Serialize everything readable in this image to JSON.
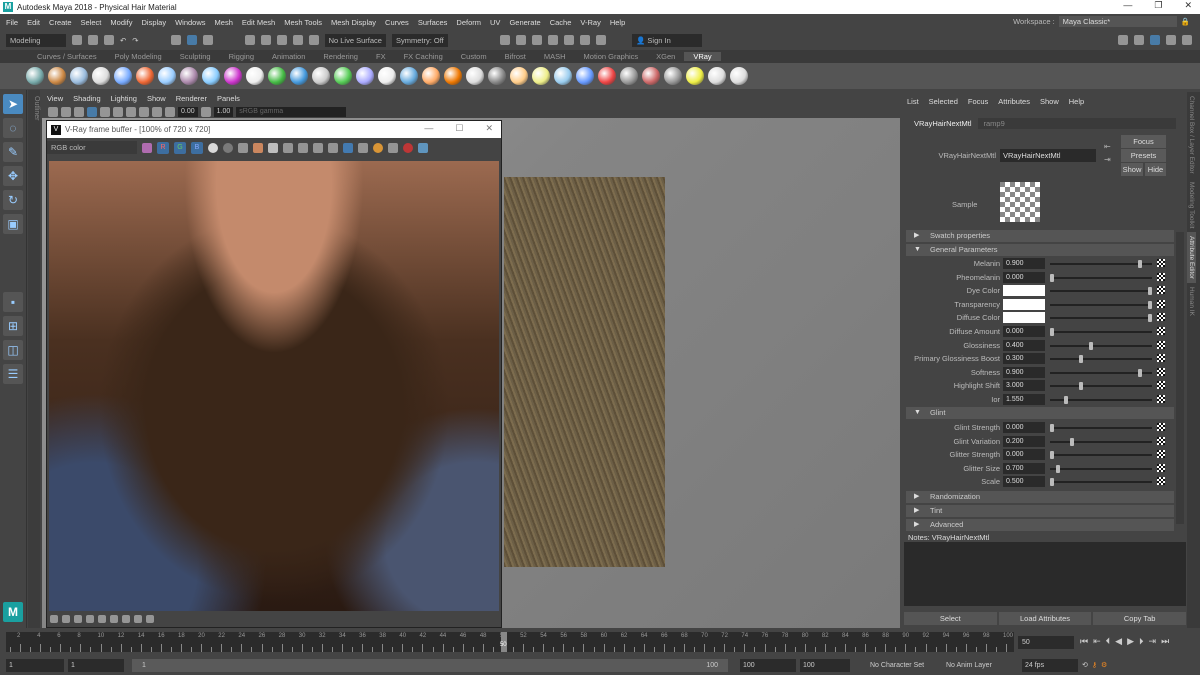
{
  "window": {
    "title": "Autodesk Maya 2018 - Physical Hair Material",
    "minimize": "—",
    "restore": "❐",
    "close": "✕",
    "logo": "M"
  },
  "menubar": {
    "items": [
      "File",
      "Edit",
      "Create",
      "Select",
      "Modify",
      "Display",
      "Windows",
      "Mesh",
      "Edit Mesh",
      "Mesh Tools",
      "Mesh Display",
      "Curves",
      "Surfaces",
      "Deform",
      "UV",
      "Generate",
      "Cache",
      "V-Ray",
      "Help"
    ],
    "workspace_label": "Workspace :",
    "workspace_value": "Maya Classic*"
  },
  "statusline": {
    "mode": "Modeling",
    "live_surface": "No Live Surface",
    "symmetry": "Symmetry: Off",
    "sign_in": "Sign In"
  },
  "shelf": {
    "tabs": [
      "Curves / Surfaces",
      "Poly Modeling",
      "Sculpting",
      "Rigging",
      "Animation",
      "Rendering",
      "FX",
      "FX Caching",
      "Custom",
      "Bifrost",
      "MASH",
      "Motion Graphics",
      "XGen",
      "VRay"
    ],
    "active": "VRay",
    "icon_colors": [
      "#7aa",
      "#c84",
      "#9bd",
      "#ddd",
      "#7af",
      "#e63",
      "#9cf",
      "#a8a",
      "#8cf",
      "#c3c",
      "#eee",
      "#4b4",
      "#49d",
      "#ccc",
      "#5c5",
      "#aaf",
      "#eee",
      "#6ad",
      "#fa6",
      "#e70",
      "#ddd",
      "#888",
      "#fc8",
      "#ee8",
      "#9ce",
      "#69f",
      "#e44",
      "#999",
      "#c66",
      "#999",
      "#ee4",
      "#ddd",
      "#ddd"
    ]
  },
  "toolbox": {
    "outliner_tab": "Outliner"
  },
  "viewport": {
    "menu": [
      "View",
      "Shading",
      "Lighting",
      "Show",
      "Renderer",
      "Panels"
    ],
    "field1": "0.00",
    "field2": "1.00",
    "colorspace": "sRGB gamma"
  },
  "vfb": {
    "title": "V-Ray frame buffer - [100% of 720 x 720]",
    "channel": "RGB color",
    "logo": "V",
    "r": "R",
    "g": "G",
    "b": "B"
  },
  "attribute_editor": {
    "menu": [
      "List",
      "Selected",
      "Focus",
      "Attributes",
      "Show",
      "Help"
    ],
    "tabs": [
      "VRayHairNextMtl",
      "ramp9"
    ],
    "node_label": "VRayHairNextMtl",
    "node_value": "VRayHairNextMtl",
    "focus": "Focus",
    "presets": "Presets",
    "show": "Show",
    "hide": "Hide",
    "sample_label": "Sample",
    "sections": {
      "swatch": "Swatch properties",
      "general": "General Parameters",
      "glint": "Glint",
      "randomization": "Randomization",
      "tint": "Tint",
      "advanced": "Advanced"
    },
    "general": [
      {
        "label": "Melanin",
        "value": "0.900",
        "slider_pos": 0.9
      },
      {
        "label": "Pheomelanin",
        "value": "0.000",
        "slider_pos": 0.0
      },
      {
        "label": "Dye Color",
        "value": "",
        "color": "#ffffff",
        "slider_pos": 1.0
      },
      {
        "label": "Transparency",
        "value": "",
        "color": "#ffffff",
        "slider_pos": 1.0
      },
      {
        "label": "Diffuse Color",
        "value": "",
        "color": "#ffffff",
        "slider_pos": 1.0
      },
      {
        "label": "Diffuse Amount",
        "value": "0.000",
        "slider_pos": 0.0
      },
      {
        "label": "Glossiness",
        "value": "0.400",
        "slider_pos": 0.4
      },
      {
        "label": "Primary Glossiness Boost",
        "value": "0.300",
        "slider_pos": 0.3
      },
      {
        "label": "Softness",
        "value": "0.900",
        "slider_pos": 0.9
      },
      {
        "label": "Highlight Shift",
        "value": "3.000",
        "slider_pos": 0.3
      },
      {
        "label": "Ior",
        "value": "1.550",
        "slider_pos": 0.14
      }
    ],
    "glint": [
      {
        "label": "Glint Strength",
        "value": "0.000",
        "slider_pos": 0.0
      },
      {
        "label": "Glint Variation",
        "value": "0.200",
        "slider_pos": 0.2
      },
      {
        "label": "Glitter Strength",
        "value": "0.000",
        "slider_pos": 0.0
      },
      {
        "label": "Glitter Size",
        "value": "0.700",
        "slider_pos": 0.06
      },
      {
        "label": "Scale",
        "value": "0.500",
        "slider_pos": 0.0
      }
    ],
    "notes_label": "Notes:  VRayHairNextMtl",
    "buttons": [
      "Select",
      "Load Attributes",
      "Copy Tab"
    ]
  },
  "right_tabs": [
    "Channel Box / Layer Editor",
    "Modeling Toolkit",
    "Attribute Editor",
    "Human IK"
  ],
  "timeline": {
    "start": 1,
    "end": 100,
    "current": "50",
    "tick_labels": [
      2,
      4,
      6,
      8,
      10,
      12,
      14,
      16,
      18,
      20,
      22,
      24,
      26,
      28,
      30,
      32,
      34,
      36,
      38,
      40,
      42,
      44,
      46,
      48,
      50,
      52,
      54,
      56,
      58,
      60,
      62,
      64,
      66,
      68,
      70,
      72,
      74,
      76,
      78,
      80,
      82,
      84,
      86,
      88,
      90,
      92,
      94,
      96,
      98,
      100
    ],
    "current_field": "50"
  },
  "range": {
    "start_field": "1",
    "current_start": "1",
    "slider_start": "1",
    "slider_end": "100",
    "end_field": "100",
    "anim_end": "100",
    "character_set": "No Character Set",
    "anim_layer": "No Anim Layer",
    "fps": "24 fps"
  }
}
